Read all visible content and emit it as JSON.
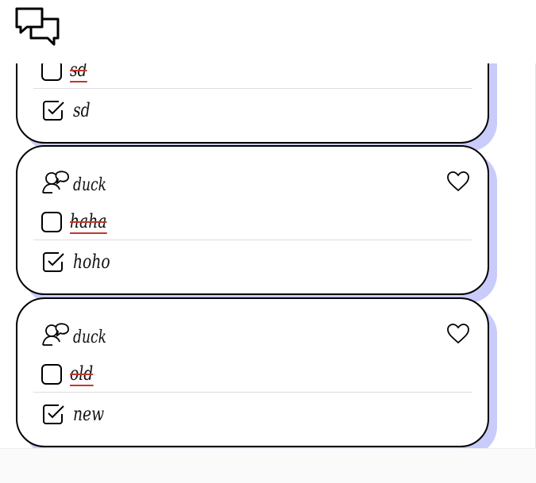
{
  "app": {
    "logo_icon": "chat-bubbles-icon"
  },
  "posts": [
    {
      "author": "",
      "items": [
        {
          "text": "sd",
          "done": false
        },
        {
          "text": "sd",
          "done": true
        }
      ]
    },
    {
      "author": "duck",
      "items": [
        {
          "text": "haha",
          "done": false
        },
        {
          "text": "hoho",
          "done": true
        }
      ]
    },
    {
      "author": "duck",
      "items": [
        {
          "text": "old",
          "done": false
        },
        {
          "text": "new",
          "done": true
        }
      ]
    }
  ],
  "colors": {
    "shadow": "#c9cbfb",
    "strike": "#c0392b",
    "border": "#000000"
  }
}
